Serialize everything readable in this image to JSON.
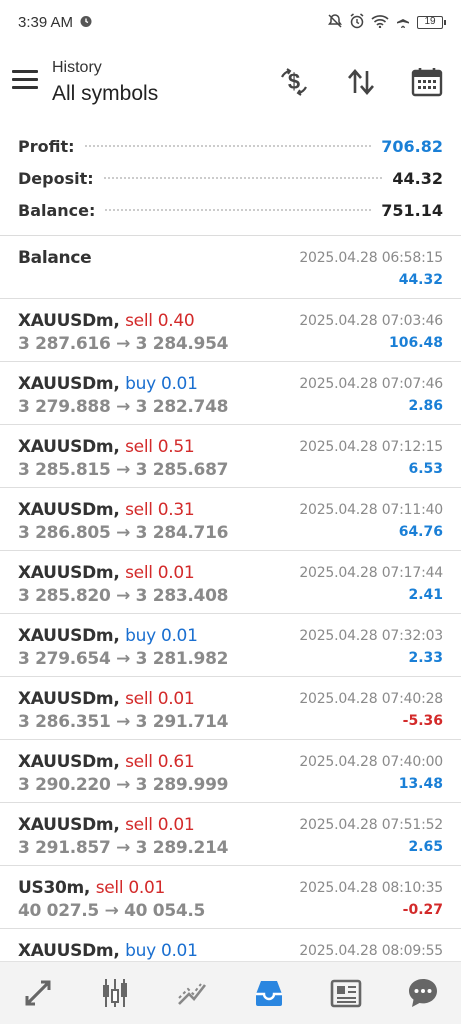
{
  "status": {
    "time": "3:39 AM",
    "battery": "19"
  },
  "header": {
    "subtitle": "History",
    "title": "All symbols"
  },
  "summary": [
    {
      "label": "Profit:",
      "value": "706.82",
      "highlight": true
    },
    {
      "label": "Deposit:",
      "value": "44.32",
      "highlight": false
    },
    {
      "label": "Balance:",
      "value": "751.14",
      "highlight": false
    }
  ],
  "list": [
    {
      "kind": "balance",
      "symbol": "Balance",
      "time": "2025.04.28 06:58:15",
      "profit": "44.32"
    },
    {
      "symbol": "XAUUSDm,",
      "type": "sell 0.40",
      "side": "sell",
      "prices": "3 287.616 → 3 284.954",
      "time": "2025.04.28 07:03:46",
      "profit": "106.48"
    },
    {
      "symbol": "XAUUSDm,",
      "type": "buy 0.01",
      "side": "buy",
      "prices": "3 279.888 → 3 282.748",
      "time": "2025.04.28 07:07:46",
      "profit": "2.86"
    },
    {
      "symbol": "XAUUSDm,",
      "type": "sell 0.51",
      "side": "sell",
      "prices": "3 285.815 → 3 285.687",
      "time": "2025.04.28 07:12:15",
      "profit": "6.53"
    },
    {
      "symbol": "XAUUSDm,",
      "type": "sell 0.31",
      "side": "sell",
      "prices": "3 286.805 → 3 284.716",
      "time": "2025.04.28 07:11:40",
      "profit": "64.76"
    },
    {
      "symbol": "XAUUSDm,",
      "type": "sell 0.01",
      "side": "sell",
      "prices": "3 285.820 → 3 283.408",
      "time": "2025.04.28 07:17:44",
      "profit": "2.41"
    },
    {
      "symbol": "XAUUSDm,",
      "type": "buy 0.01",
      "side": "buy",
      "prices": "3 279.654 → 3 281.982",
      "time": "2025.04.28 07:32:03",
      "profit": "2.33"
    },
    {
      "symbol": "XAUUSDm,",
      "type": "sell 0.01",
      "side": "sell",
      "prices": "3 286.351 → 3 291.714",
      "time": "2025.04.28 07:40:28",
      "profit": "-5.36"
    },
    {
      "symbol": "XAUUSDm,",
      "type": "sell 0.61",
      "side": "sell",
      "prices": "3 290.220 → 3 289.999",
      "time": "2025.04.28 07:40:00",
      "profit": "13.48"
    },
    {
      "symbol": "XAUUSDm,",
      "type": "sell 0.01",
      "side": "sell",
      "prices": "3 291.857 → 3 289.214",
      "time": "2025.04.28 07:51:52",
      "profit": "2.65"
    },
    {
      "symbol": "US30m,",
      "type": "sell 0.01",
      "side": "sell",
      "prices": "40 027.5 → 40 054.5",
      "time": "2025.04.28 08:10:35",
      "profit": "-0.27"
    },
    {
      "symbol": "XAUUSDm,",
      "type": "buy 0.01",
      "side": "buy",
      "prices": "",
      "time": "2025.04.28 08:09:55",
      "profit": ""
    }
  ],
  "bottomnav": [
    "quotes-icon",
    "chart-icon",
    "trade-icon",
    "history-icon",
    "news-icon",
    "chat-icon"
  ],
  "colors": {
    "accent": "#1a7fd6",
    "sell": "#d32a2a",
    "buy": "#1a6fd0",
    "muted": "#8a8a8a"
  }
}
